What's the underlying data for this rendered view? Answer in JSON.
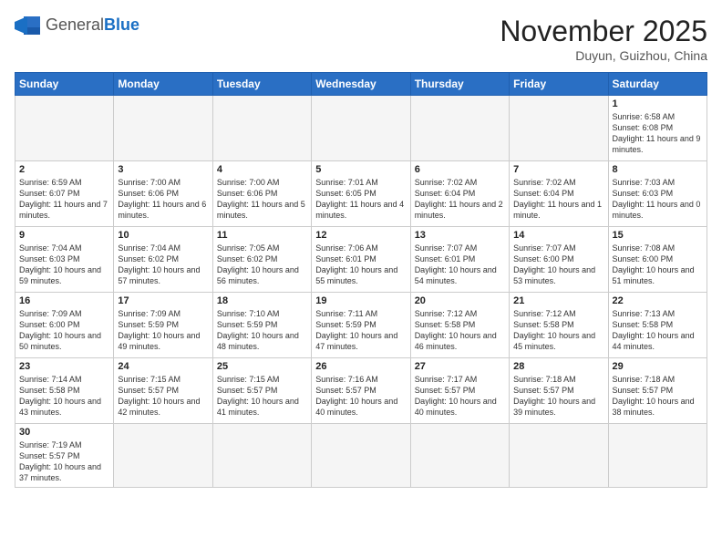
{
  "header": {
    "logo_general": "General",
    "logo_blue": "Blue",
    "month_title": "November 2025",
    "location": "Duyun, Guizhou, China"
  },
  "weekdays": [
    "Sunday",
    "Monday",
    "Tuesday",
    "Wednesday",
    "Thursday",
    "Friday",
    "Saturday"
  ],
  "weeks": [
    [
      {
        "day": "",
        "info": ""
      },
      {
        "day": "",
        "info": ""
      },
      {
        "day": "",
        "info": ""
      },
      {
        "day": "",
        "info": ""
      },
      {
        "day": "",
        "info": ""
      },
      {
        "day": "",
        "info": ""
      },
      {
        "day": "1",
        "info": "Sunrise: 6:58 AM\nSunset: 6:08 PM\nDaylight: 11 hours and 9 minutes."
      }
    ],
    [
      {
        "day": "2",
        "info": "Sunrise: 6:59 AM\nSunset: 6:07 PM\nDaylight: 11 hours and 7 minutes."
      },
      {
        "day": "3",
        "info": "Sunrise: 7:00 AM\nSunset: 6:06 PM\nDaylight: 11 hours and 6 minutes."
      },
      {
        "day": "4",
        "info": "Sunrise: 7:00 AM\nSunset: 6:06 PM\nDaylight: 11 hours and 5 minutes."
      },
      {
        "day": "5",
        "info": "Sunrise: 7:01 AM\nSunset: 6:05 PM\nDaylight: 11 hours and 4 minutes."
      },
      {
        "day": "6",
        "info": "Sunrise: 7:02 AM\nSunset: 6:04 PM\nDaylight: 11 hours and 2 minutes."
      },
      {
        "day": "7",
        "info": "Sunrise: 7:02 AM\nSunset: 6:04 PM\nDaylight: 11 hours and 1 minute."
      },
      {
        "day": "8",
        "info": "Sunrise: 7:03 AM\nSunset: 6:03 PM\nDaylight: 11 hours and 0 minutes."
      }
    ],
    [
      {
        "day": "9",
        "info": "Sunrise: 7:04 AM\nSunset: 6:03 PM\nDaylight: 10 hours and 59 minutes."
      },
      {
        "day": "10",
        "info": "Sunrise: 7:04 AM\nSunset: 6:02 PM\nDaylight: 10 hours and 57 minutes."
      },
      {
        "day": "11",
        "info": "Sunrise: 7:05 AM\nSunset: 6:02 PM\nDaylight: 10 hours and 56 minutes."
      },
      {
        "day": "12",
        "info": "Sunrise: 7:06 AM\nSunset: 6:01 PM\nDaylight: 10 hours and 55 minutes."
      },
      {
        "day": "13",
        "info": "Sunrise: 7:07 AM\nSunset: 6:01 PM\nDaylight: 10 hours and 54 minutes."
      },
      {
        "day": "14",
        "info": "Sunrise: 7:07 AM\nSunset: 6:00 PM\nDaylight: 10 hours and 53 minutes."
      },
      {
        "day": "15",
        "info": "Sunrise: 7:08 AM\nSunset: 6:00 PM\nDaylight: 10 hours and 51 minutes."
      }
    ],
    [
      {
        "day": "16",
        "info": "Sunrise: 7:09 AM\nSunset: 6:00 PM\nDaylight: 10 hours and 50 minutes."
      },
      {
        "day": "17",
        "info": "Sunrise: 7:09 AM\nSunset: 5:59 PM\nDaylight: 10 hours and 49 minutes."
      },
      {
        "day": "18",
        "info": "Sunrise: 7:10 AM\nSunset: 5:59 PM\nDaylight: 10 hours and 48 minutes."
      },
      {
        "day": "19",
        "info": "Sunrise: 7:11 AM\nSunset: 5:59 PM\nDaylight: 10 hours and 47 minutes."
      },
      {
        "day": "20",
        "info": "Sunrise: 7:12 AM\nSunset: 5:58 PM\nDaylight: 10 hours and 46 minutes."
      },
      {
        "day": "21",
        "info": "Sunrise: 7:12 AM\nSunset: 5:58 PM\nDaylight: 10 hours and 45 minutes."
      },
      {
        "day": "22",
        "info": "Sunrise: 7:13 AM\nSunset: 5:58 PM\nDaylight: 10 hours and 44 minutes."
      }
    ],
    [
      {
        "day": "23",
        "info": "Sunrise: 7:14 AM\nSunset: 5:58 PM\nDaylight: 10 hours and 43 minutes."
      },
      {
        "day": "24",
        "info": "Sunrise: 7:15 AM\nSunset: 5:57 PM\nDaylight: 10 hours and 42 minutes."
      },
      {
        "day": "25",
        "info": "Sunrise: 7:15 AM\nSunset: 5:57 PM\nDaylight: 10 hours and 41 minutes."
      },
      {
        "day": "26",
        "info": "Sunrise: 7:16 AM\nSunset: 5:57 PM\nDaylight: 10 hours and 40 minutes."
      },
      {
        "day": "27",
        "info": "Sunrise: 7:17 AM\nSunset: 5:57 PM\nDaylight: 10 hours and 40 minutes."
      },
      {
        "day": "28",
        "info": "Sunrise: 7:18 AM\nSunset: 5:57 PM\nDaylight: 10 hours and 39 minutes."
      },
      {
        "day": "29",
        "info": "Sunrise: 7:18 AM\nSunset: 5:57 PM\nDaylight: 10 hours and 38 minutes."
      }
    ],
    [
      {
        "day": "30",
        "info": "Sunrise: 7:19 AM\nSunset: 5:57 PM\nDaylight: 10 hours and 37 minutes."
      },
      {
        "day": "",
        "info": ""
      },
      {
        "day": "",
        "info": ""
      },
      {
        "day": "",
        "info": ""
      },
      {
        "day": "",
        "info": ""
      },
      {
        "day": "",
        "info": ""
      },
      {
        "day": "",
        "info": ""
      }
    ]
  ]
}
